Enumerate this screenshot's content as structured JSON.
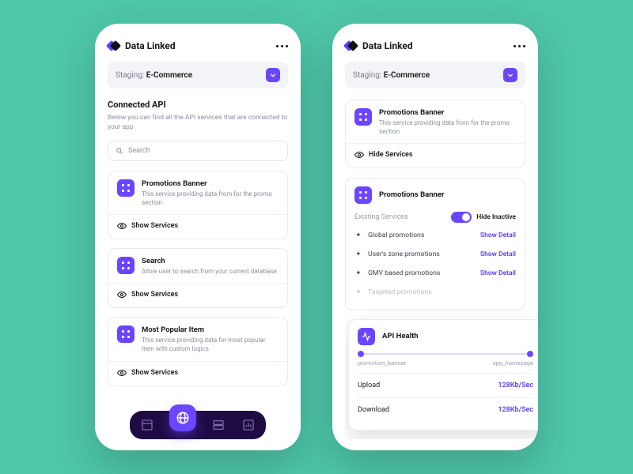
{
  "brand": "Data Linked",
  "staging_prefix": "Staging:",
  "staging_value": "E-Commerce",
  "left": {
    "title": "Connected API",
    "desc": "Below you can find all the API services that are connected to your app",
    "search_placeholder": "Search",
    "cards": [
      {
        "title": "Promotions Banner",
        "desc": "This service providing data from for the promo section",
        "toggle": "Show Services"
      },
      {
        "title": "Search",
        "desc": "Allow user to search from your current database",
        "toggle": "Show Services"
      },
      {
        "title": "Most Popular Item",
        "desc": "This service providing data for most popular item with custom logics",
        "toggle": "Show Services"
      }
    ]
  },
  "right": {
    "top_card": {
      "title": "Promotions Banner",
      "desc": "This service providing data from for the promo section",
      "toggle": "Hide Services"
    },
    "detail": {
      "title": "Promotions Banner",
      "subtitle": "Existing Services",
      "hide_inactive_label": "Hide Inactive",
      "services": [
        {
          "name": "Global promotions",
          "action": "Show Detail",
          "disabled": false
        },
        {
          "name": "User's zone promotions",
          "action": "Show Detail",
          "disabled": false
        },
        {
          "name": "GMV based promotions",
          "action": "Show Detail",
          "disabled": false
        },
        {
          "name": "Targeted promotions",
          "action": "",
          "disabled": true
        }
      ]
    },
    "health": {
      "title": "API Health",
      "endpoint_a": "promotion_banner",
      "endpoint_b": "app_homepage",
      "stats": [
        {
          "label": "Upload",
          "value": "128Kb/Sec"
        },
        {
          "label": "Download",
          "value": "128Kb/Sec"
        }
      ]
    }
  }
}
